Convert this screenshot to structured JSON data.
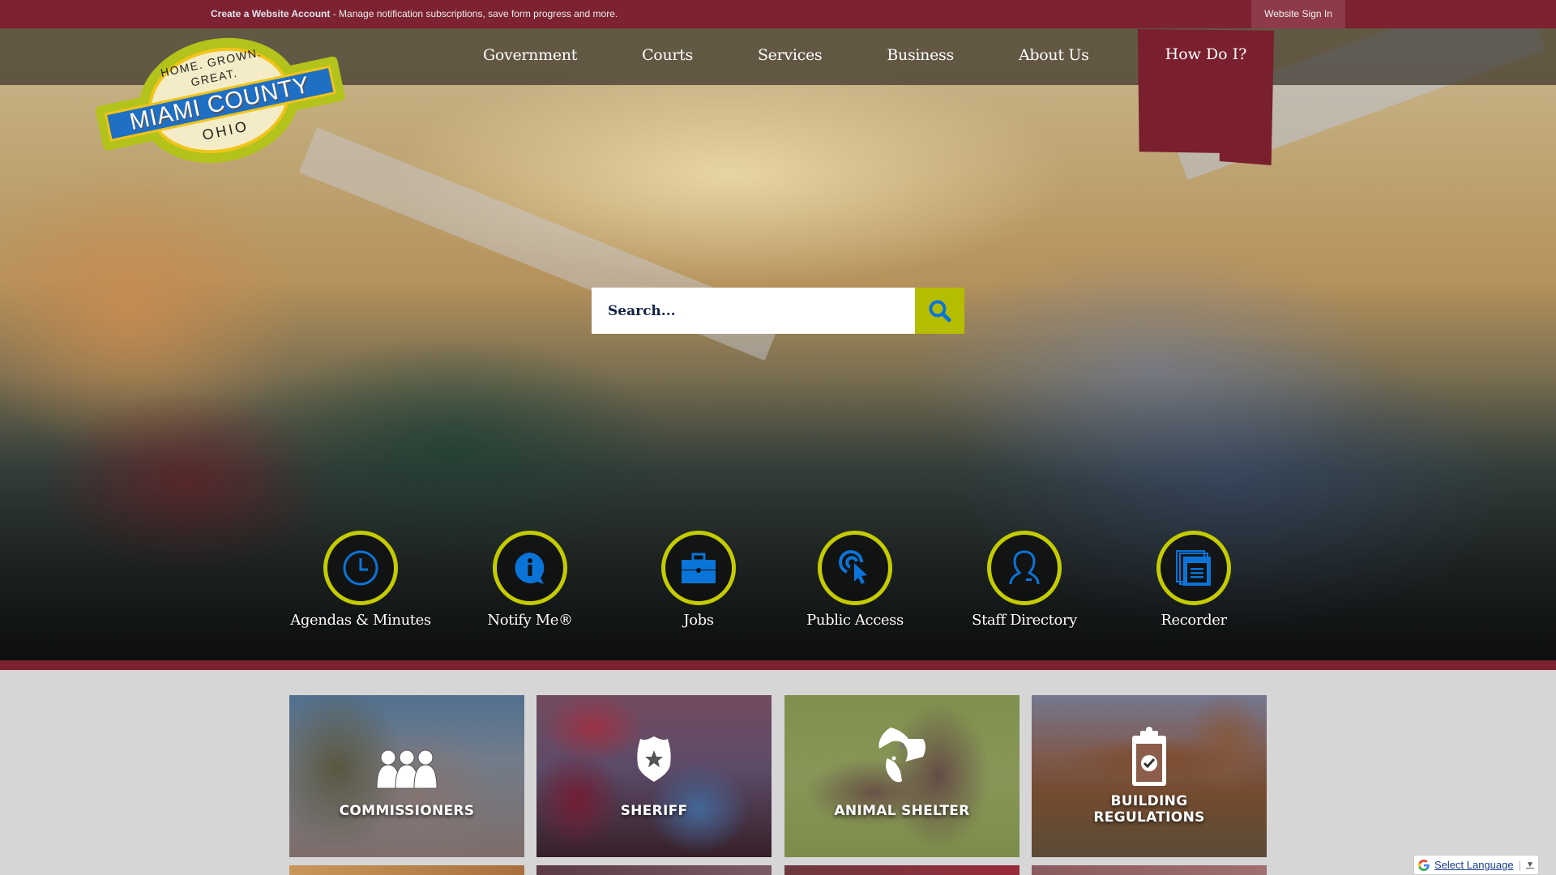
{
  "topbar": {
    "account_link": "Create a Website Account",
    "account_text": " - Manage notification subscriptions, save form progress and more.",
    "signin_label": "Website Sign In"
  },
  "logo": {
    "tagline_top": "HOME. GROWN.",
    "tagline_mid": "GREAT.",
    "name": "MIAMI COUNTY",
    "state": "OHIO"
  },
  "nav": {
    "items": [
      {
        "label": "Government"
      },
      {
        "label": "Courts"
      },
      {
        "label": "Services"
      },
      {
        "label": "Business"
      },
      {
        "label": "About Us"
      }
    ],
    "how_do_i": "How Do I?"
  },
  "search": {
    "placeholder": "Search...",
    "value": "",
    "button_icon": "search-icon"
  },
  "quick_links": [
    {
      "label": "Agendas & Minutes",
      "icon": "clock-icon"
    },
    {
      "label": "Notify Me®",
      "icon": "info-bubble-icon"
    },
    {
      "label": "Jobs",
      "icon": "briefcase-icon"
    },
    {
      "label": "Public Access",
      "icon": "pointer-click-icon"
    },
    {
      "label": "Staff Directory",
      "icon": "person-icon"
    },
    {
      "label": "Recorder",
      "icon": "documents-icon"
    }
  ],
  "tiles": [
    {
      "label": "COMMISSIONERS",
      "icon": "group-icon"
    },
    {
      "label": "SHERIFF",
      "icon": "badge-icon"
    },
    {
      "label": "ANIMAL SHELTER",
      "icon": "dog-cat-icon"
    },
    {
      "label_line1": "BUILDING",
      "label_line2": "REGULATIONS",
      "icon": "clipboard-check-icon"
    }
  ],
  "translate": {
    "label": "Select Language",
    "arrow": "▼"
  },
  "colors": {
    "brand_maroon": "#7c2230",
    "accent_lime": "#c4cc00",
    "icon_blue": "#0b74d8",
    "search_button": "#b5bd00"
  }
}
